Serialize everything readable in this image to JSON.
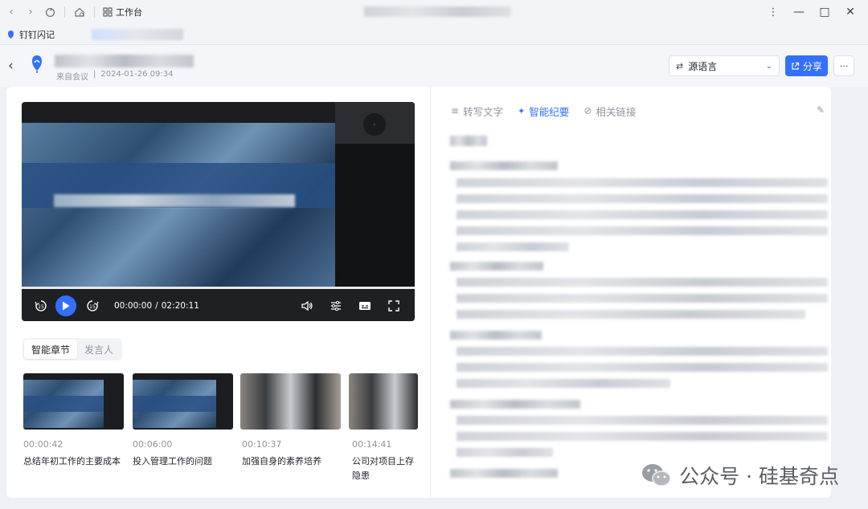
{
  "titlebar": {
    "workspace_label": "工作台",
    "nav_back": "‹",
    "nav_forward": "›",
    "more": "⋮",
    "minimize": "—",
    "maximize": "□",
    "close": "✕"
  },
  "tabbar": {
    "tab_label": "钉钉闪记"
  },
  "header": {
    "source_label": "来自会议",
    "sep": "|",
    "datetime": "2024-01-26 09:34",
    "language_select": "源语言",
    "share_label": "分享",
    "more_label": "···"
  },
  "player": {
    "current_time": "00:00:00",
    "duration_sep": "/",
    "duration": "02:20:11",
    "rewind_label": "15",
    "forward_label": "15",
    "progress_fraction": 0
  },
  "segments": {
    "chapters": "智能章节",
    "speakers": "发言人"
  },
  "chapters": [
    {
      "time": "00:00:42",
      "title": "总结年初工作的主要成本"
    },
    {
      "time": "00:06:00",
      "title": "投入管理工作的问题"
    },
    {
      "time": "00:10:37",
      "title": "加强自身的素养培养"
    },
    {
      "time": "00:14:41",
      "title": "公司对项目上存",
      "title2": "隐患"
    }
  ],
  "right_tabs": {
    "transcript": "转写文字",
    "minutes": "智能纪要",
    "links": "相关链接"
  },
  "watermark": {
    "text": "公众号 · 硅基奇点"
  },
  "colors": {
    "accent": "#3370ff",
    "background": "#eef0f6"
  }
}
